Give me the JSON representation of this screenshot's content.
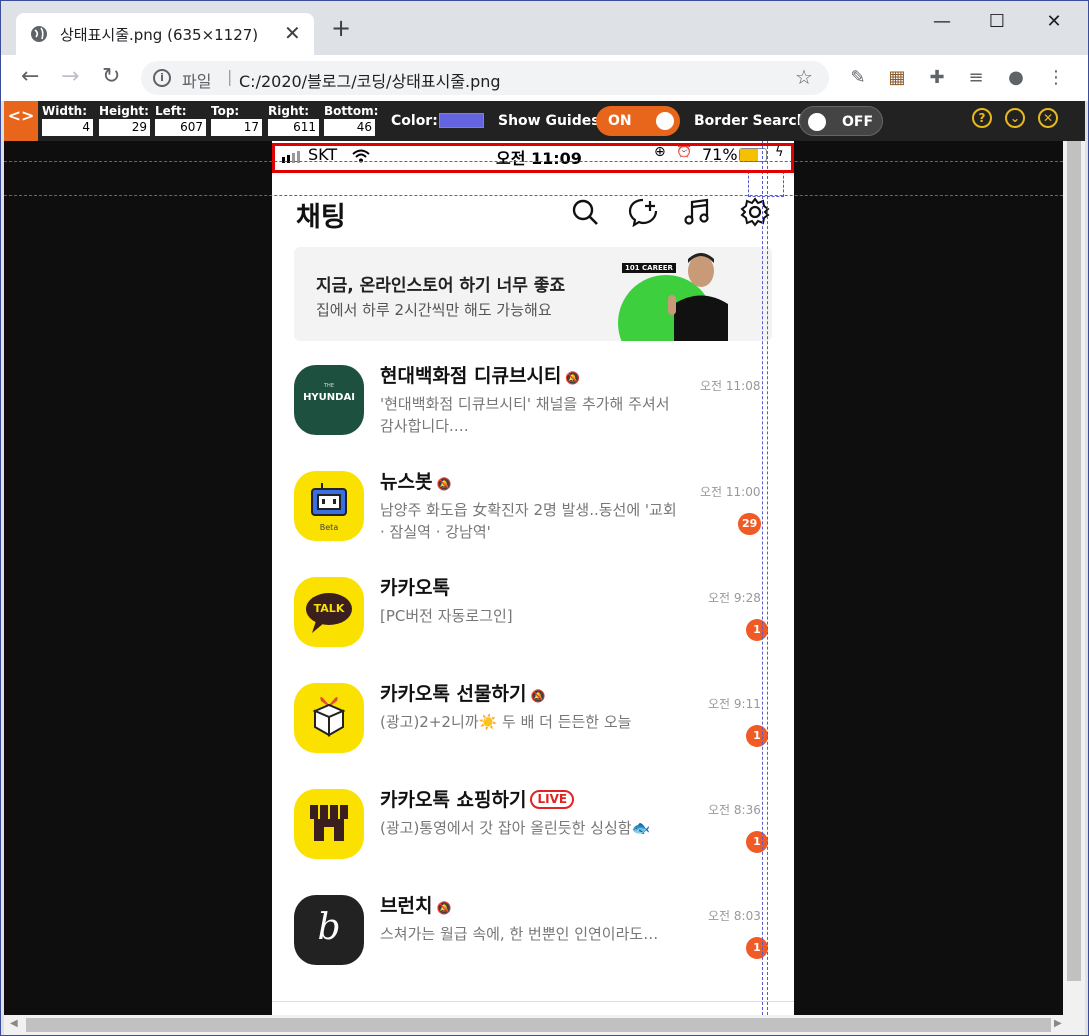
{
  "browser": {
    "tab_title": "상태표시줄.png (635×1127)",
    "url_scheme": "파일",
    "url": "C:/2020/블로그/코딩/상태표시줄.png"
  },
  "pageguide": {
    "fields": [
      {
        "label": "Width:",
        "value": "4"
      },
      {
        "label": "Height:",
        "value": "29"
      },
      {
        "label": "Left:",
        "value": "607"
      },
      {
        "label": "Top:",
        "value": "17"
      },
      {
        "label": "Right:",
        "value": "611"
      },
      {
        "label": "Bottom:",
        "value": "46"
      }
    ],
    "color_label": "Color:",
    "color_value": "#6464e0",
    "show_guides_label": "Show Guides:",
    "show_guides_state": "ON",
    "border_search_label": "Border Search:",
    "border_search_state": "OFF"
  },
  "phone": {
    "status": {
      "carrier": "SKT",
      "time": "오전 11:09",
      "battery": "71%"
    },
    "header_title": "채팅",
    "banner": {
      "line1": "지금, 온라인스토어 하기 너무 좋죠",
      "line2": "집에서 하루 2시간씩만 해도 가능해요",
      "tag": "101 CAREER"
    },
    "chats": [
      {
        "name": "현대백화점 디큐브시티",
        "muted": true,
        "live": false,
        "message": "'현대백화점 디큐브시티' 채널을 추가해 주셔서 감사합니다.…",
        "time": "오전 11:08",
        "badge": "",
        "avatar_text": "HYUNDAI",
        "avatar_color": "#1e5040"
      },
      {
        "name": "뉴스봇",
        "muted": true,
        "live": false,
        "message": "남양주 화도읍 女확진자 2명 발생..동선에 '교회 · 잠실역 · 강남역'",
        "time": "오전 11:00",
        "badge": "29",
        "avatar_text": "Beta",
        "avatar_color": "#fae100"
      },
      {
        "name": "카카오톡",
        "muted": false,
        "live": false,
        "message": "[PC버전 자동로그인]",
        "time": "오전 9:28",
        "badge": "1",
        "avatar_text": "TALK",
        "avatar_color": "#fae100"
      },
      {
        "name": "카카오톡 선물하기",
        "muted": true,
        "live": false,
        "message": "(광고)2+2니까☀️ 두 배 더 든든한 오늘",
        "time": "오전 9:11",
        "badge": "1",
        "avatar_text": "",
        "avatar_color": "#fae100"
      },
      {
        "name": "카카오톡 쇼핑하기",
        "muted": false,
        "live": true,
        "live_label": "LIVE",
        "message": "(광고)통영에서 갓 잡아 올린듯한 싱싱함🐟",
        "time": "오전 8:36",
        "badge": "1",
        "avatar_text": "",
        "avatar_color": "#fae100"
      },
      {
        "name": "브런치",
        "muted": true,
        "live": false,
        "message": "스쳐가는 월급 속에, 한 번뿐인 인연이라도…",
        "time": "오전 8:03",
        "badge": "1",
        "avatar_text": "b",
        "avatar_color": "#222222"
      }
    ]
  }
}
